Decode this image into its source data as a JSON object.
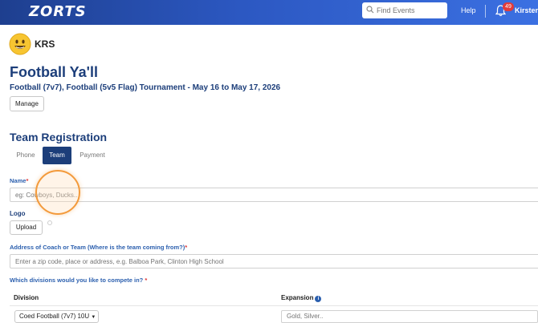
{
  "header": {
    "logo": "ZORTS",
    "search_placeholder": "Find Events",
    "help": "Help",
    "notification_count": "49",
    "user": "Kirsten"
  },
  "org": {
    "name": "KRS"
  },
  "event": {
    "title": "Football Ya'll",
    "subtitle": "Football (7v7), Football (5v5 Flag) Tournament  -  May 16 to May 17, 2026",
    "manage": "Manage"
  },
  "registration": {
    "heading": "Team Registration",
    "tabs": [
      {
        "label": "Phone",
        "active": false
      },
      {
        "label": "Team",
        "active": true
      },
      {
        "label": "Payment",
        "active": false
      }
    ],
    "name_label": "Name",
    "name_required": "*",
    "name_placeholder": "eg: Cowboys, Ducks..",
    "logo_label": "Logo",
    "upload": "Upload",
    "address_label": "Address of Coach or Team (Where is the team coming from?)",
    "address_required": "*",
    "address_placeholder": "Enter a zip code, place or address, e.g. Balboa Park, Clinton High School",
    "divisions_label": "Which divisions would you like to compete in?",
    "divisions_required": "*",
    "table": {
      "col_division": "Division",
      "col_expansion": "Expansion",
      "division_value": "Coed Football (7v7) 10U",
      "expansion_placeholder": "Gold, Silver.."
    }
  },
  "colors": {
    "brand": "#1c3e7a",
    "accent": "#2b5fae",
    "header": "#2c58c2",
    "highlight": "#f39a3b"
  }
}
